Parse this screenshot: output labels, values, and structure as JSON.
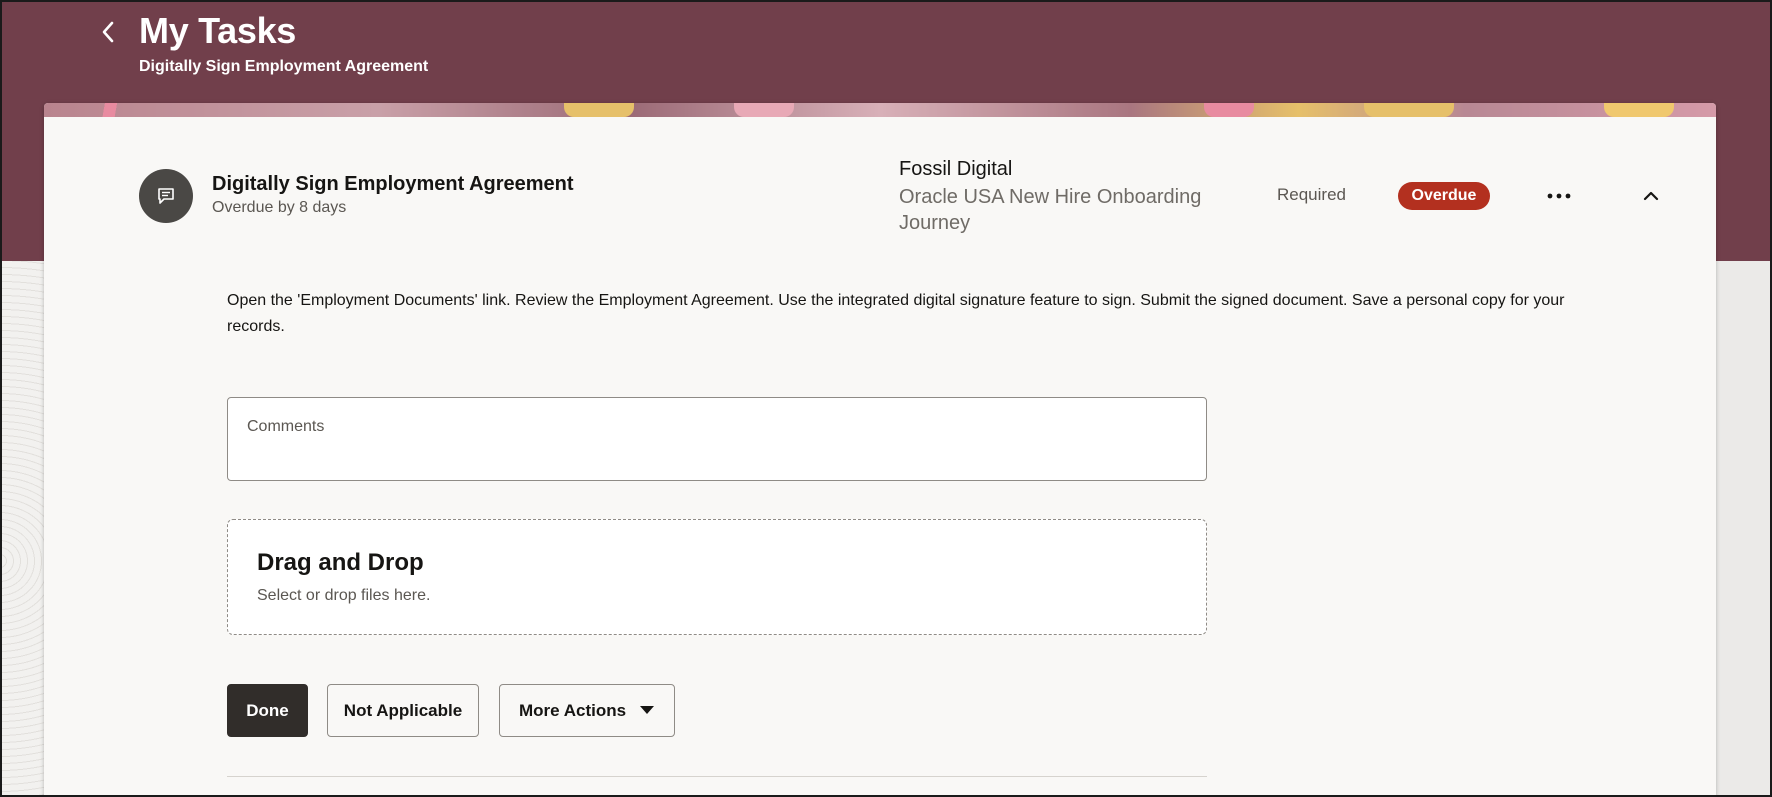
{
  "header": {
    "title": "My Tasks",
    "subtitle": "Digitally Sign Employment Agreement"
  },
  "task": {
    "icon": "message-icon",
    "title": "Digitally Sign Employment Agreement",
    "overdue_text": "Overdue by 8 days",
    "organization": "Fossil Digital",
    "journey": "Oracle USA New Hire Onboarding Journey",
    "required_label": "Required",
    "status_badge": "Overdue",
    "instructions": "Open the 'Employment Documents' link. Review the Employment Agreement. Use the integrated digital signature feature to sign. Submit the signed document. Save a personal copy for your records."
  },
  "comments": {
    "label": "Comments",
    "value": ""
  },
  "dropzone": {
    "title": "Drag and Drop",
    "subtitle": "Select or drop files here."
  },
  "actions": {
    "done_label": "Done",
    "not_applicable_label": "Not Applicable",
    "more_actions_label": "More Actions"
  },
  "colors": {
    "header_band": "#713f4b",
    "overdue_badge": "#b3301f",
    "primary_button": "#312d2a"
  }
}
